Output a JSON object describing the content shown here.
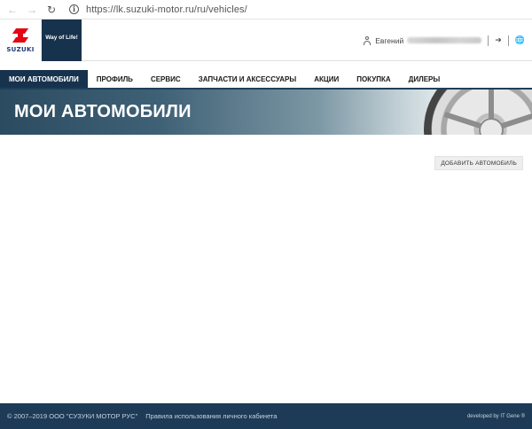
{
  "browser": {
    "back_icon": "arrow-left-icon",
    "forward_icon": "arrow-right-icon",
    "reload_icon": "reload-icon",
    "url": "https://lk.suzuki-motor.ru/ru/vehicles/"
  },
  "header": {
    "logo_text": "SUZUKI",
    "slogan": "Way of Life!",
    "user_first_name": "Евгений"
  },
  "nav": {
    "items": [
      {
        "label": "МОИ АВТОМОБИЛИ",
        "active": true
      },
      {
        "label": "ПРОФИЛЬ"
      },
      {
        "label": "СЕРВИС"
      },
      {
        "label": "ЗАПЧАСТИ И АКСЕССУАРЫ"
      },
      {
        "label": "АКЦИИ"
      },
      {
        "label": "ПОКУПКА"
      },
      {
        "label": "ДИЛЕРЫ"
      }
    ]
  },
  "banner": {
    "title": "МОИ АВТОМОБИЛИ"
  },
  "content": {
    "add_vehicle_label": "ДОБАВИТЬ АВТОМОБИЛЬ"
  },
  "footer": {
    "copyright": "© 2007–2019 ООО \"СУЗУКИ МОТОР РУС\"",
    "terms_link": "Правила использования личного кабинета",
    "developer": "developed by IT Gene ®"
  },
  "colors": {
    "nav_active_bg": "#17324d",
    "footer_bg": "#1d3b57",
    "logo_red": "#e30613"
  }
}
